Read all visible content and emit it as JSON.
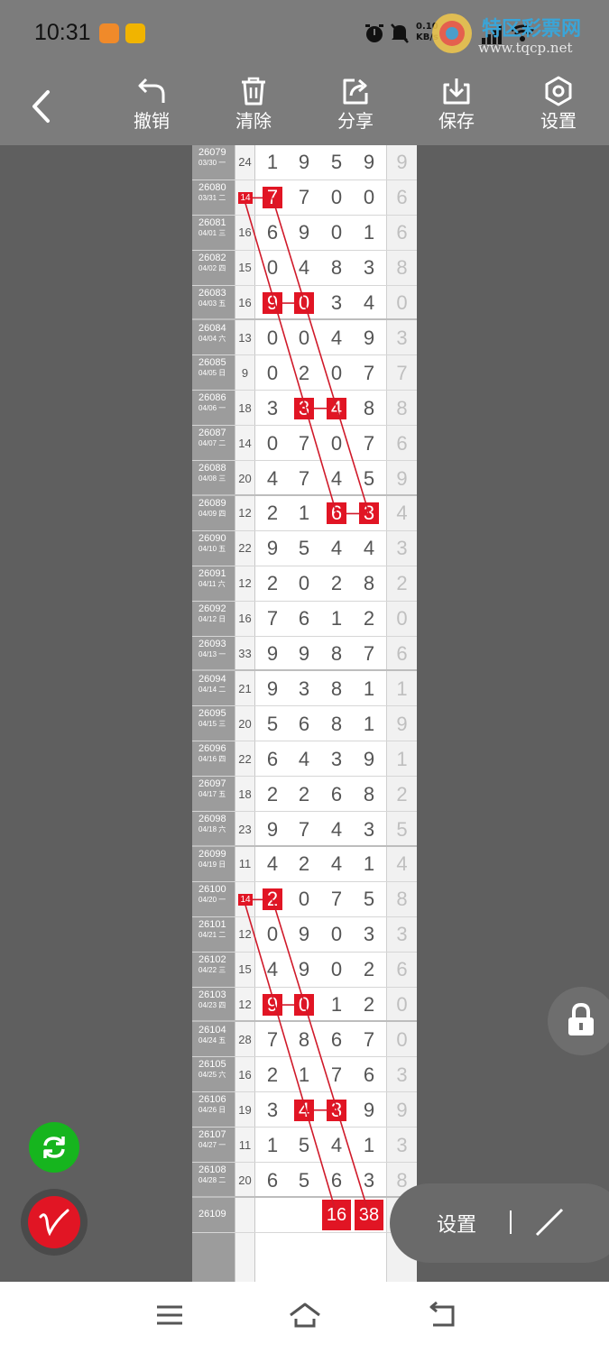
{
  "status_bar": {
    "time": "10:31",
    "net_speed": "0.10 KB/s",
    "network": "5G"
  },
  "watermark": {
    "title": "特区彩票网",
    "url": "www.tqcp.net"
  },
  "toolbar": {
    "undo": "撤销",
    "clear": "清除",
    "share": "分享",
    "save": "保存",
    "settings": "设置"
  },
  "table": {
    "rows": [
      {
        "issue": "26079",
        "date": "03/30 一",
        "sum": "24",
        "digits": [
          1,
          9,
          5,
          9
        ],
        "last": 9
      },
      {
        "issue": "26080",
        "date": "03/31 二",
        "sum": "14",
        "digits": [
          7,
          7,
          0,
          0
        ],
        "last": 6
      },
      {
        "issue": "26081",
        "date": "04/01 三",
        "sum": "16",
        "digits": [
          6,
          9,
          0,
          1
        ],
        "last": 6
      },
      {
        "issue": "26082",
        "date": "04/02 四",
        "sum": "15",
        "digits": [
          0,
          4,
          8,
          3
        ],
        "last": 8
      },
      {
        "issue": "26083",
        "date": "04/03 五",
        "sum": "16",
        "digits": [
          9,
          0,
          3,
          4
        ],
        "last": 0
      },
      {
        "issue": "26084",
        "date": "04/04 六",
        "sum": "13",
        "digits": [
          0,
          0,
          4,
          9
        ],
        "last": 3
      },
      {
        "issue": "26085",
        "date": "04/05 日",
        "sum": "9",
        "digits": [
          0,
          2,
          0,
          7
        ],
        "last": 7
      },
      {
        "issue": "26086",
        "date": "04/06 一",
        "sum": "18",
        "digits": [
          3,
          3,
          4,
          8
        ],
        "last": 8
      },
      {
        "issue": "26087",
        "date": "04/07 二",
        "sum": "14",
        "digits": [
          0,
          7,
          0,
          7
        ],
        "last": 6
      },
      {
        "issue": "26088",
        "date": "04/08 三",
        "sum": "20",
        "digits": [
          4,
          7,
          4,
          5
        ],
        "last": 9
      },
      {
        "issue": "26089",
        "date": "04/09 四",
        "sum": "12",
        "digits": [
          2,
          1,
          6,
          3
        ],
        "last": 4
      },
      {
        "issue": "26090",
        "date": "04/10 五",
        "sum": "22",
        "digits": [
          9,
          5,
          4,
          4
        ],
        "last": 3
      },
      {
        "issue": "26091",
        "date": "04/11 六",
        "sum": "12",
        "digits": [
          2,
          0,
          2,
          8
        ],
        "last": 2
      },
      {
        "issue": "26092",
        "date": "04/12 日",
        "sum": "16",
        "digits": [
          7,
          6,
          1,
          2
        ],
        "last": 0
      },
      {
        "issue": "26093",
        "date": "04/13 一",
        "sum": "33",
        "digits": [
          9,
          9,
          8,
          7
        ],
        "last": 6
      },
      {
        "issue": "26094",
        "date": "04/14 二",
        "sum": "21",
        "digits": [
          9,
          3,
          8,
          1
        ],
        "last": 1
      },
      {
        "issue": "26095",
        "date": "04/15 三",
        "sum": "20",
        "digits": [
          5,
          6,
          8,
          1
        ],
        "last": 9
      },
      {
        "issue": "26096",
        "date": "04/16 四",
        "sum": "22",
        "digits": [
          6,
          4,
          3,
          9
        ],
        "last": 1
      },
      {
        "issue": "26097",
        "date": "04/17 五",
        "sum": "18",
        "digits": [
          2,
          2,
          6,
          8
        ],
        "last": 2
      },
      {
        "issue": "26098",
        "date": "04/18 六",
        "sum": "23",
        "digits": [
          9,
          7,
          4,
          3
        ],
        "last": 5
      },
      {
        "issue": "26099",
        "date": "04/19 日",
        "sum": "11",
        "digits": [
          4,
          2,
          4,
          1
        ],
        "last": 4
      },
      {
        "issue": "26100",
        "date": "04/20 一",
        "sum": "14",
        "digits": [
          2,
          0,
          7,
          5
        ],
        "last": 8
      },
      {
        "issue": "26101",
        "date": "04/21 二",
        "sum": "12",
        "digits": [
          0,
          9,
          0,
          3
        ],
        "last": 3
      },
      {
        "issue": "26102",
        "date": "04/22 三",
        "sum": "15",
        "digits": [
          4,
          9,
          0,
          2
        ],
        "last": 6
      },
      {
        "issue": "26103",
        "date": "04/23 四",
        "sum": "12",
        "digits": [
          9,
          0,
          1,
          2
        ],
        "last": 0
      },
      {
        "issue": "26104",
        "date": "04/24 五",
        "sum": "28",
        "digits": [
          7,
          8,
          6,
          7
        ],
        "last": 0
      },
      {
        "issue": "26105",
        "date": "04/25 六",
        "sum": "16",
        "digits": [
          2,
          1,
          7,
          6
        ],
        "last": 3
      },
      {
        "issue": "26106",
        "date": "04/26 日",
        "sum": "19",
        "digits": [
          3,
          4,
          3,
          9
        ],
        "last": 9
      },
      {
        "issue": "26107",
        "date": "04/27 一",
        "sum": "11",
        "digits": [
          1,
          5,
          4,
          1
        ],
        "last": 3
      },
      {
        "issue": "26108",
        "date": "04/28 二",
        "sum": "20",
        "digits": [
          6,
          5,
          6,
          3
        ],
        "last": 8
      }
    ],
    "pending_issue": "26109",
    "pending_values": [
      "16",
      "38"
    ],
    "tag_label": "14"
  },
  "highlights": [
    {
      "row": 1,
      "col": 0
    },
    {
      "row": 4,
      "col": 0
    },
    {
      "row": 4,
      "col": 1
    },
    {
      "row": 7,
      "col": 1
    },
    {
      "row": 7,
      "col": 2
    },
    {
      "row": 10,
      "col": 2
    },
    {
      "row": 10,
      "col": 3
    },
    {
      "row": 21,
      "col": 0
    },
    {
      "row": 24,
      "col": 0
    },
    {
      "row": 24,
      "col": 1
    },
    {
      "row": 27,
      "col": 1
    },
    {
      "row": 27,
      "col": 2
    }
  ],
  "float_panel": {
    "settings": "设置"
  },
  "colors": {
    "highlight": "#e11524",
    "refresh": "#16b51e"
  }
}
